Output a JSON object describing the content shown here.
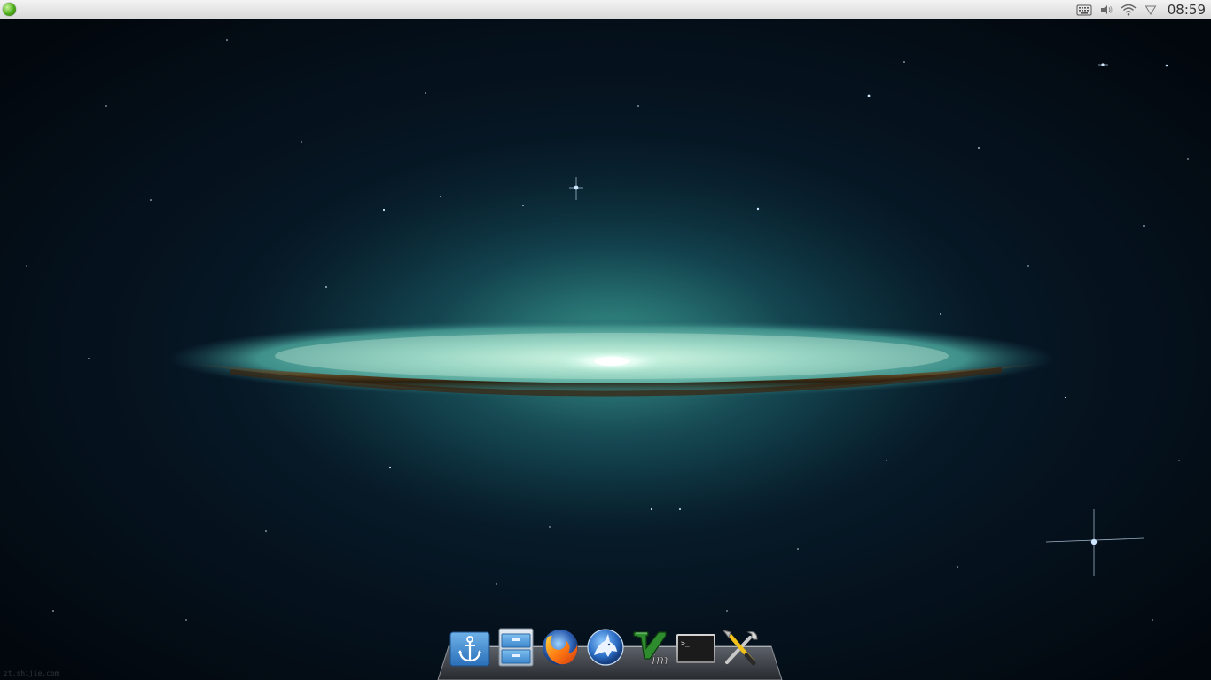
{
  "topbar": {
    "menu_icon": "green-orb-menu-icon",
    "tray_icons": [
      "keyboard-icon",
      "volume-icon",
      "wifi-icon",
      "battery-icon"
    ],
    "clock": "08:59"
  },
  "dock": {
    "items": [
      {
        "name": "dock-anchor-icon",
        "label": "Docky"
      },
      {
        "name": "file-manager-icon",
        "label": "Files"
      },
      {
        "name": "firefox-icon",
        "label": "Firefox"
      },
      {
        "name": "wolf-browser-icon",
        "label": "Browser"
      },
      {
        "name": "vim-icon",
        "label": "Vim"
      },
      {
        "name": "terminal-icon",
        "label": "Terminal"
      },
      {
        "name": "settings-tools-icon",
        "label": "Settings"
      }
    ]
  },
  "wallpaper": {
    "watermark": "zt.shijie.com"
  },
  "colors": {
    "topbar_bg": "#e3e3e3",
    "galaxy_glow": "#3aa79a",
    "space_dark": "#02070d"
  }
}
